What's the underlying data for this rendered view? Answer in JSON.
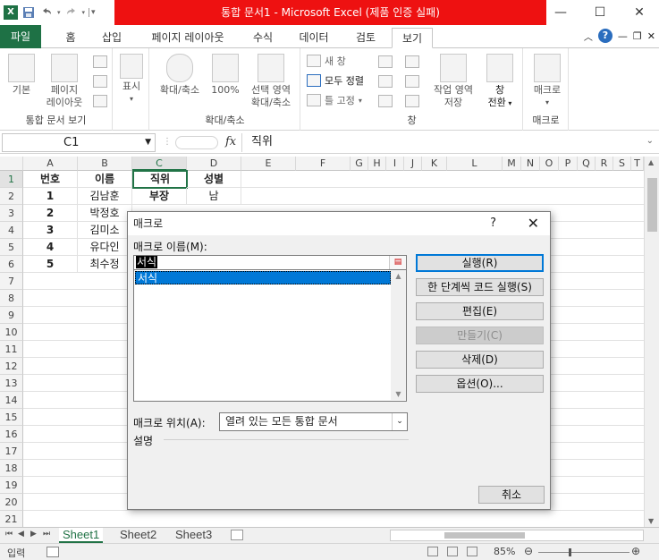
{
  "title_bar": {
    "title": "통합 문서1 - Microsoft Excel (제품 인증 실패)",
    "window_buttons": [
      "—",
      "☐",
      "✕"
    ]
  },
  "ribbon_tabs": {
    "file": "파일",
    "items": [
      "홈",
      "삽입",
      "페이지 레이아웃",
      "수식",
      "데이터",
      "검토",
      "보기"
    ],
    "active": "보기"
  },
  "ribbon": {
    "workbook_views": {
      "label": "통합 문서 보기",
      "normal": "기본",
      "page_layout_line1": "페이지",
      "page_layout_line2": "레이아웃"
    },
    "show": {
      "label": "표시"
    },
    "zoom": {
      "label": "확대/축소",
      "zoom": "확대/축소",
      "percent100": "100%",
      "zoom_sel_line1": "선택 영역",
      "zoom_sel_line2": "확대/축소"
    },
    "window": {
      "label": "창",
      "new_window": "새 창",
      "arrange_all": "모두 정렬",
      "freeze_panes": "틀 고정",
      "save_ws_line1": "작업 영역",
      "save_ws_line2": "저장",
      "switch_line1": "창",
      "switch_line2": "전환"
    },
    "macros": {
      "label": "매크로",
      "button": "매크로"
    }
  },
  "formula_bar": {
    "name_box": "C1",
    "fx": "fx",
    "value": "직위"
  },
  "grid": {
    "columns": [
      "A",
      "B",
      "C",
      "D",
      "E",
      "F",
      "G",
      "H",
      "I",
      "J",
      "K",
      "L",
      "M",
      "N",
      "O",
      "P",
      "Q",
      "R",
      "S",
      "T"
    ],
    "rows": [
      "1",
      "2",
      "3",
      "4",
      "5",
      "6",
      "7",
      "8",
      "9",
      "10",
      "11",
      "12",
      "13",
      "14",
      "15",
      "16",
      "17",
      "18",
      "19",
      "20",
      "21"
    ],
    "cells": {
      "A1": "번호",
      "B1": "이름",
      "C1": "직위",
      "D1": "성별",
      "A2": "1",
      "B2": "김남훈",
      "C2": "부장",
      "D2": "남",
      "A3": "2",
      "B3": "박정호",
      "A4": "3",
      "B4": "김미소",
      "A5": "4",
      "B5": "유다인",
      "A6": "5",
      "B6": "최수정"
    }
  },
  "sheets": {
    "tabs": [
      "Sheet1",
      "Sheet2",
      "Sheet3"
    ],
    "active": "Sheet1"
  },
  "status_bar": {
    "mode": "입력",
    "zoom": "85%"
  },
  "macro_dialog": {
    "title": "매크로",
    "help": "?",
    "close": "✕",
    "name_label": "매크로 이름(M):",
    "name_value": "서식",
    "list_items": [
      "서식"
    ],
    "buttons": {
      "run": "실행(R)",
      "step_into": "한 단계씩 코드 실행(S)",
      "edit": "편집(E)",
      "create": "만들기(C)",
      "delete": "삭제(D)",
      "options": "옵션(O)...",
      "cancel": "취소"
    },
    "location_label": "매크로 위치(A):",
    "location_value": "열려 있는 모든 통합 문서",
    "description_label": "설명"
  }
}
